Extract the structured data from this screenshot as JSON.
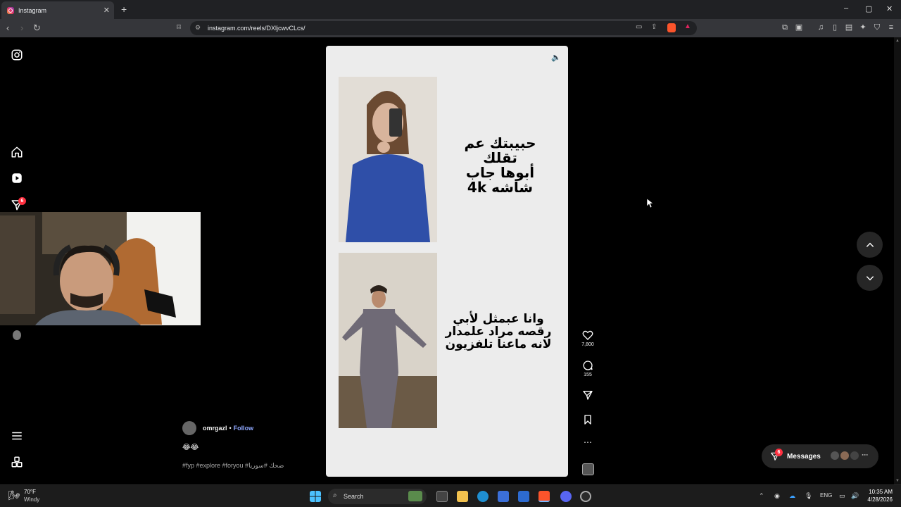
{
  "browser": {
    "tab_title": "Instagram",
    "new_tab": "+",
    "tab_close": "✕",
    "url": "instagram.com/reels/DXljcwvCLcs/",
    "window_controls": [
      "–",
      "▢",
      "✕"
    ]
  },
  "sidebar": {
    "notifications_badge": "6"
  },
  "reel": {
    "text_top": [
      "حبيبتك عم تقلك",
      "أبوها جاب",
      "شاشه 4k"
    ],
    "text_bottom": [
      "وانا عبمثل لأبي",
      "رقصه مراد علمدار",
      "لانه ماعنا تلفزيون"
    ]
  },
  "actions": {
    "likes": "7,800",
    "comments": "155"
  },
  "post": {
    "username": "omrgazl",
    "separator": "•",
    "follow": "Follow",
    "emojis": "😂😂",
    "hashtags": "#fyp #explore #foryou #ضحك #سوريا"
  },
  "messages": {
    "label": "Messages",
    "badge": "6"
  },
  "taskbar": {
    "weather_temp": "70°F",
    "weather_desc": "Windy",
    "search_placeholder": "Search",
    "language": "ENG",
    "time": "10:35 AM",
    "date": "4/28/2026"
  },
  "colors": {
    "accent": "#ff3040",
    "follow": "#8fa8ff"
  }
}
